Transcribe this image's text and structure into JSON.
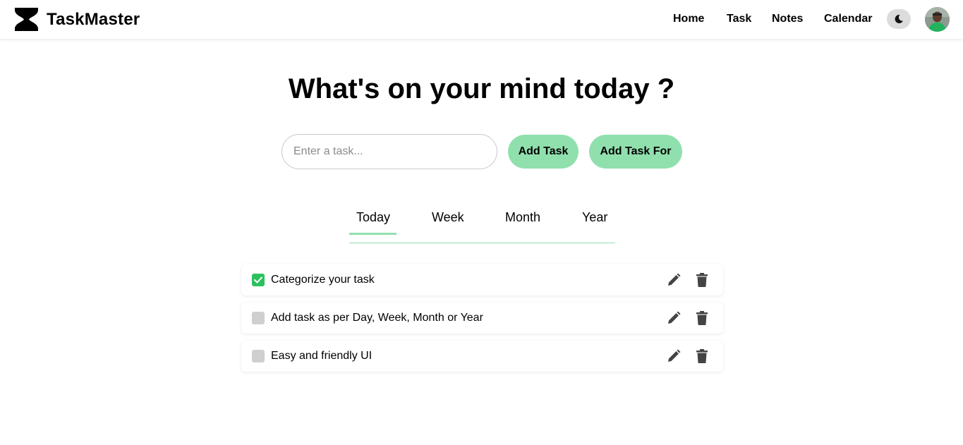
{
  "app": {
    "name": "TaskMaster",
    "logo_icon": "hourglass-icon"
  },
  "nav": {
    "items": [
      {
        "label": "Home"
      },
      {
        "label": "Task"
      },
      {
        "label": "Notes"
      },
      {
        "label": "Calendar"
      }
    ],
    "theme_toggle_icon": "moon-icon",
    "avatar_icon": "user-avatar"
  },
  "main": {
    "headline": "What's on your mind today ?",
    "input": {
      "placeholder": "Enter a task...",
      "value": ""
    },
    "buttons": {
      "add_task": "Add Task",
      "add_task_for": "Add Task For"
    },
    "tabs": [
      {
        "label": "Today",
        "active": true
      },
      {
        "label": "Week",
        "active": false
      },
      {
        "label": "Month",
        "active": false
      },
      {
        "label": "Year",
        "active": false
      }
    ],
    "tasks": [
      {
        "text": "Categorize your task",
        "done": true
      },
      {
        "text": "Add task as per Day, Week, Month or Year",
        "done": false
      },
      {
        "text": "Easy and friendly UI",
        "done": false
      }
    ]
  },
  "colors": {
    "accent": "#90e0ae",
    "checked": "#2ec05f",
    "unchecked": "#cfcfcf",
    "icon": "#444444"
  }
}
